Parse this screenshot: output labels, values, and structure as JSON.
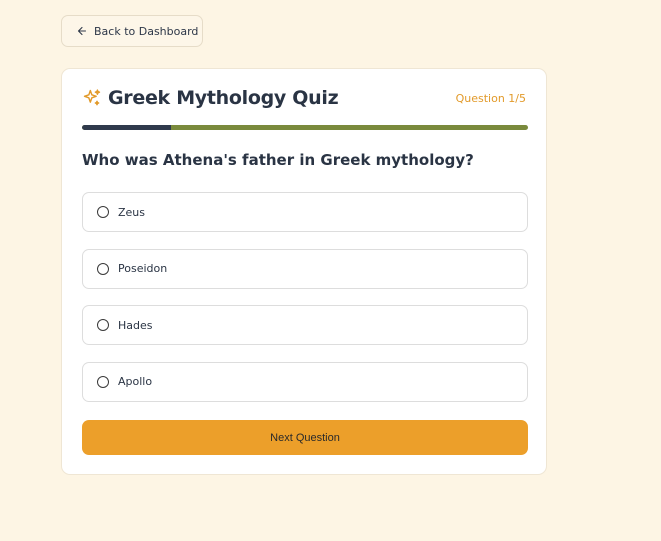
{
  "nav": {
    "back_label": "Back to Dashboard",
    "back_icon": "arrow-left-icon"
  },
  "quiz": {
    "title": "Greek Mythology Quiz",
    "title_icon": "sparkles-icon",
    "question_counter": "Question 1/5",
    "progress_fraction": 0.2,
    "question": "Who was Athena's father in Greek mythology?",
    "options": [
      "Zeus",
      "Poseidon",
      "Hades",
      "Apollo"
    ],
    "next_label": "Next Question"
  },
  "colors": {
    "background": "#fdf5e4",
    "accent": "#ec9f2a",
    "progress_fill": "#2f3a4c",
    "progress_track": "#7a8a3c",
    "text": "#2a3444"
  }
}
